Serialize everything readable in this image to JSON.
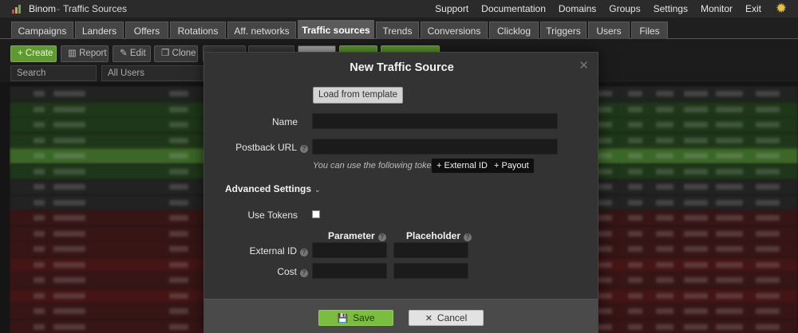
{
  "app": {
    "name": "Binom",
    "separator": "-",
    "page": "Traffic Sources"
  },
  "topnav": [
    "Support",
    "Documentation",
    "Domains",
    "Groups",
    "Settings",
    "Monitor",
    "Exit"
  ],
  "tabs": [
    "Campaigns",
    "Landers",
    "Offers",
    "Rotations",
    "Aff. networks",
    "Traffic sources",
    "Trends",
    "Conversions",
    "Clicklog",
    "Triggers",
    "Users",
    "Files"
  ],
  "active_tab": "Traffic sources",
  "toolbar": {
    "create": "+ Create",
    "report": "Report",
    "edit": "Edit",
    "clone": "Clone"
  },
  "filters": {
    "search_placeholder": "Search",
    "users_select": "All Users"
  },
  "modal": {
    "title": "New Traffic Source",
    "load_template": "Load from template",
    "name_label": "Name",
    "name_value": "",
    "postback_label": "Postback URL",
    "postback_value": "",
    "tokens_hint": "You can use the following tokens:",
    "tokens": [
      "+ External ID",
      "+ Payout"
    ],
    "advanced_settings": "Advanced Settings",
    "use_tokens_label": "Use Tokens",
    "use_tokens_checked": false,
    "parameter_header": "Parameter",
    "placeholder_header": "Placeholder",
    "rows": [
      {
        "label": "External ID",
        "parameter": "",
        "placeholder": ""
      },
      {
        "label": "Cost",
        "parameter": "",
        "placeholder": ""
      }
    ],
    "save": "Save",
    "cancel": "Cancel"
  },
  "colors": {
    "accent_green": "#7bbd3e",
    "row_green": "#3f6b27",
    "row_red": "#5a1c1c"
  }
}
